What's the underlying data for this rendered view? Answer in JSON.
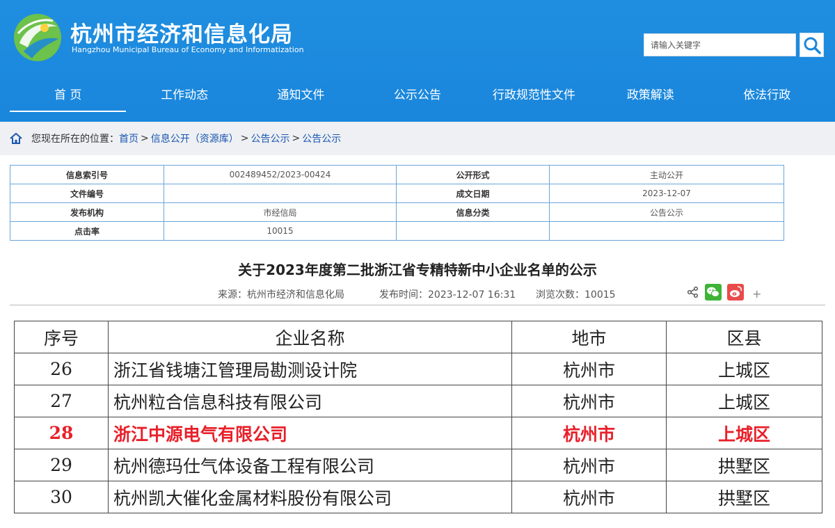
{
  "header": {
    "title": "杭州市经济和信息化局",
    "subtitle": "Hangzhou Municipal Bureau of Economy and Informatization",
    "brand_color": "#1a86dc",
    "search_placeholder": "请输入关键字",
    "search_icon": "search-icon"
  },
  "nav": {
    "items": [
      {
        "label": "首 页",
        "active": true
      },
      {
        "label": "工作动态",
        "active": false
      },
      {
        "label": "通知文件",
        "active": false
      },
      {
        "label": "公示公告",
        "active": false
      },
      {
        "label": "行政规范性文件",
        "active": false
      },
      {
        "label": "政策解读",
        "active": false
      },
      {
        "label": "依法行政",
        "active": false
      }
    ]
  },
  "breadcrumb": {
    "prefix": "您现在所在的位置：",
    "items": [
      {
        "label": "首页"
      },
      {
        "label": "信息公开（资源库）"
      },
      {
        "label": "公告公示"
      },
      {
        "label": "公告公示"
      }
    ],
    "separator": ">"
  },
  "info": {
    "rows": [
      {
        "l1": "信息索引号",
        "v1": "002489452/2023-00424",
        "l2": "公开形式",
        "v2": "主动公开"
      },
      {
        "l1": "文件编号",
        "v1": "",
        "l2": "成文日期",
        "v2": "2023-12-07"
      },
      {
        "l1": "发布机构",
        "v1": "市经信局",
        "l2": "信息分类",
        "v2": "公告公示"
      },
      {
        "l1": "点击率",
        "v1": "10015",
        "l2": "",
        "v2": ""
      }
    ]
  },
  "article": {
    "title": "关于2023年度第二批浙江省专精特新中小企业名单的公示",
    "source": "来源：杭州市经济和信息化局",
    "publish_time": "发布时间：2023-12-07 16:31",
    "views": "浏览次数：10015",
    "share_more": "+"
  },
  "list": {
    "headers": [
      "序号",
      "企业名称",
      "地市",
      "区县"
    ],
    "highlight_color": "#e8202a",
    "rows": [
      {
        "no": "26",
        "name": "浙江省钱塘江管理局勘测设计院",
        "city": "杭州市",
        "district": "上城区",
        "highlight": false
      },
      {
        "no": "27",
        "name": "杭州粒合信息科技有限公司",
        "city": "杭州市",
        "district": "上城区",
        "highlight": false
      },
      {
        "no": "28",
        "name": "浙江中源电气有限公司",
        "city": "杭州市",
        "district": "上城区",
        "highlight": true
      },
      {
        "no": "29",
        "name": "杭州德玛仕气体设备工程有限公司",
        "city": "杭州市",
        "district": "拱墅区",
        "highlight": false
      },
      {
        "no": "30",
        "name": "杭州凯大催化金属材料股份有限公司",
        "city": "杭州市",
        "district": "拱墅区",
        "highlight": false
      }
    ]
  }
}
